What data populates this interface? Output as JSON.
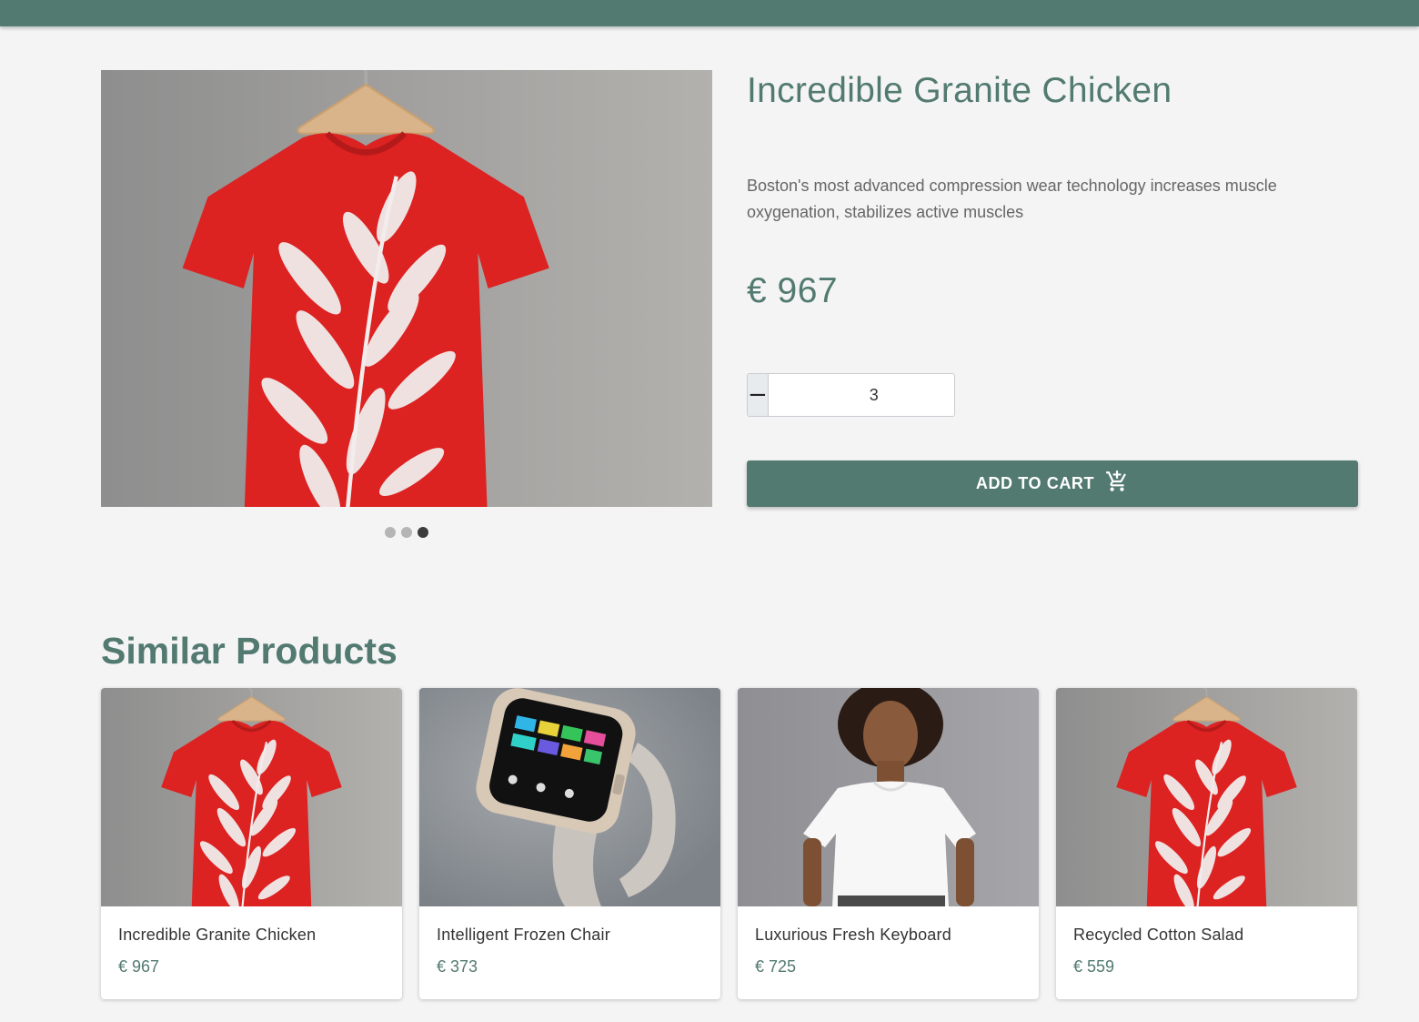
{
  "colors": {
    "accent": "#527a70",
    "background": "#f4f4f4"
  },
  "product": {
    "title": "Incredible Granite Chicken",
    "description": "Boston's most advanced compression wear technology increases muscle oxygenation, stabilizes active muscles",
    "price": "€ 967",
    "quantity": "3",
    "image": "red-tshirt-on-hanger",
    "carousel": {
      "count": 3,
      "active_index": 2
    }
  },
  "actions": {
    "decrement_label": "−",
    "increment_label": "+",
    "add_to_cart_label": "ADD TO CART",
    "cart_icon": "add-shopping-cart-icon"
  },
  "similar": {
    "heading": "Similar Products",
    "items": [
      {
        "name": "Incredible Granite Chicken",
        "price": "€ 967",
        "image": "red-tshirt-on-hanger"
      },
      {
        "name": "Intelligent Frozen Chair",
        "price": "€ 373",
        "image": "smartwatch"
      },
      {
        "name": "Luxurious Fresh Keyboard",
        "price": "€ 725",
        "image": "woman-white-tshirt"
      },
      {
        "name": "Recycled Cotton Salad",
        "price": "€ 559",
        "image": "red-tshirt-on-hanger"
      }
    ]
  }
}
